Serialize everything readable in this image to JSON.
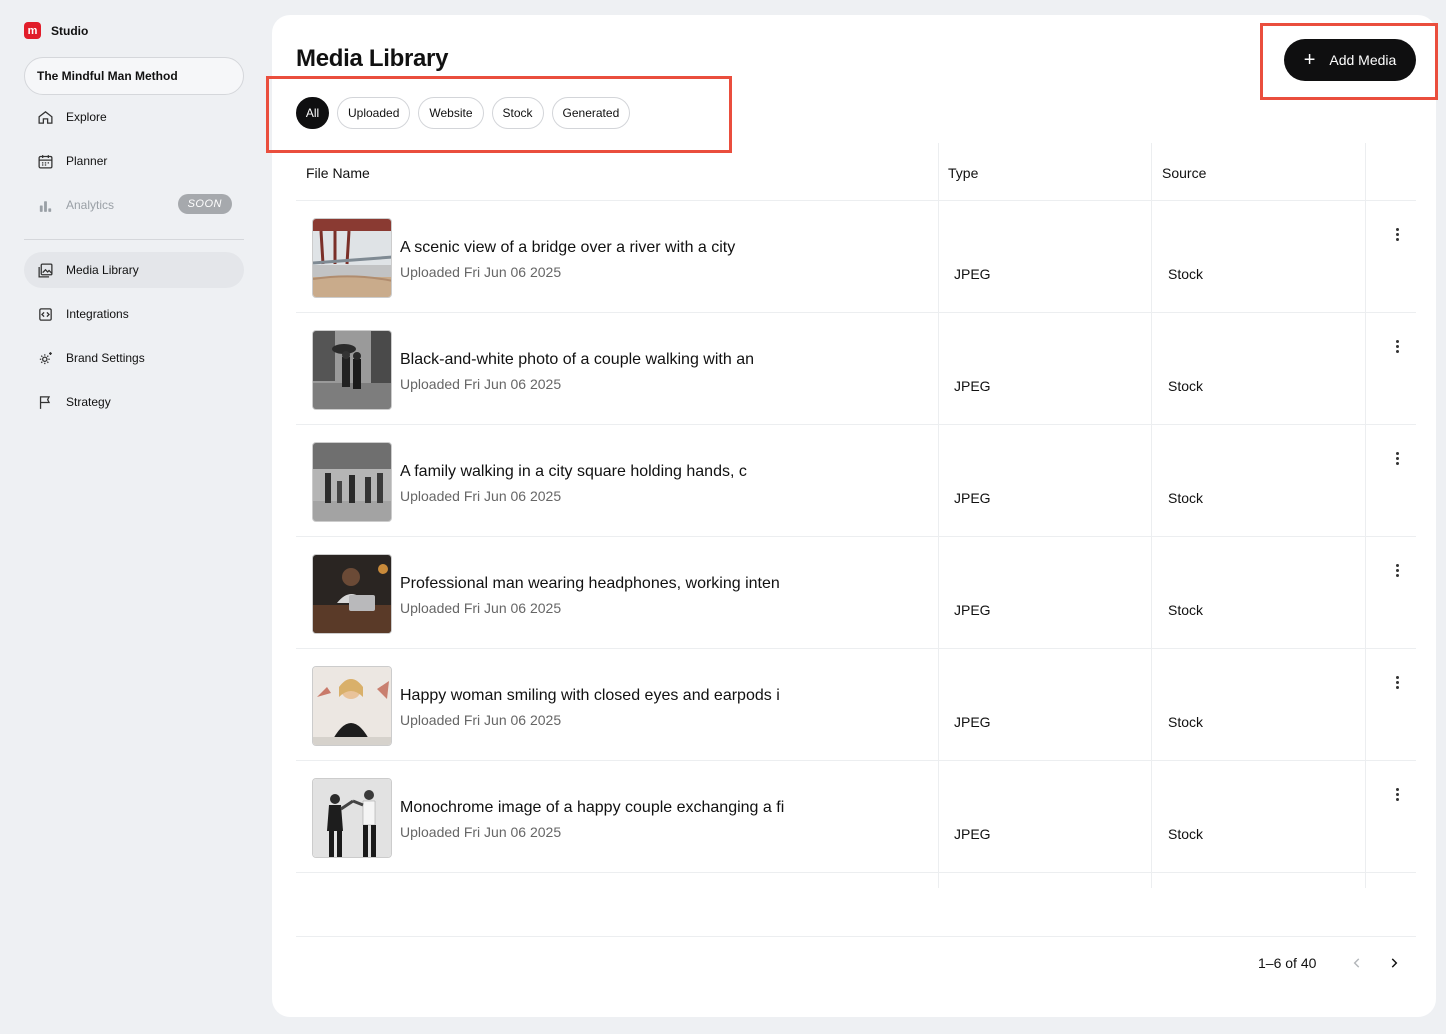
{
  "app": {
    "name": "Studio",
    "logo_letter": "m",
    "accent": "#e11d2a"
  },
  "workspace": {
    "name": "The Mindful Man Method"
  },
  "sidebar": {
    "items": [
      {
        "label": "Explore",
        "icon": "home-icon"
      },
      {
        "label": "Planner",
        "icon": "calendar-icon"
      },
      {
        "label": "Analytics",
        "icon": "bar-chart-icon",
        "badge": "SOON",
        "disabled": true
      },
      {
        "label": "Media Library",
        "icon": "image-gallery-icon",
        "active": true
      },
      {
        "label": "Integrations",
        "icon": "code-plug-icon"
      },
      {
        "label": "Brand Settings",
        "icon": "gear-sparkle-icon"
      },
      {
        "label": "Strategy",
        "icon": "flag-icon"
      }
    ]
  },
  "main": {
    "title": "Media Library",
    "add_button": "Add Media",
    "filters": [
      "All",
      "Uploaded",
      "Website",
      "Stock",
      "Generated"
    ],
    "active_filter": "All",
    "columns": {
      "name": "File Name",
      "type": "Type",
      "source": "Source"
    },
    "rows": [
      {
        "title": "A scenic view of a bridge over a river with a city",
        "subtitle": "Uploaded Fri Jun 06 2025",
        "type": "JPEG",
        "source": "Stock"
      },
      {
        "title": "Black-and-white photo of a couple walking with an",
        "subtitle": "Uploaded Fri Jun 06 2025",
        "type": "JPEG",
        "source": "Stock"
      },
      {
        "title": "A family walking in a city square holding hands, c",
        "subtitle": "Uploaded Fri Jun 06 2025",
        "type": "JPEG",
        "source": "Stock"
      },
      {
        "title": "Professional man wearing headphones, working inten",
        "subtitle": "Uploaded Fri Jun 06 2025",
        "type": "JPEG",
        "source": "Stock"
      },
      {
        "title": "Happy woman smiling with closed eyes and earpods i",
        "subtitle": "Uploaded Fri Jun 06 2025",
        "type": "JPEG",
        "source": "Stock"
      },
      {
        "title": "Monochrome image of a happy couple exchanging a fi",
        "subtitle": "Uploaded Fri Jun 06 2025",
        "type": "JPEG",
        "source": "Stock"
      }
    ],
    "pagination": {
      "range": "1–6 of 40"
    }
  }
}
